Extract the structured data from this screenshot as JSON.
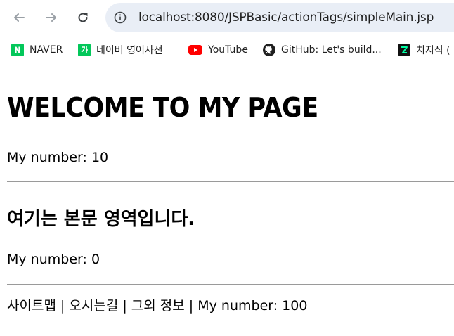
{
  "browser": {
    "url": "localhost:8080/JSPBasic/actionTags/simpleMain.jsp",
    "bookmarks": [
      {
        "label": "NAVER",
        "icon": "naver-icon"
      },
      {
        "label": "네이버 영어사전",
        "icon": "naver-dictionary-icon"
      },
      {
        "label": "YouTube",
        "icon": "youtube-icon"
      },
      {
        "label": "GitHub: Let's build...",
        "icon": "github-icon"
      },
      {
        "label": "치지직 (",
        "icon": "chzzk-icon"
      }
    ]
  },
  "page": {
    "header_title": "WELCOME TO MY PAGE",
    "header_number": "My number: 10",
    "body_title": "여기는 본문 영역입니다.",
    "body_number": "My number: 0",
    "footer_text": "사이트맵 | 오시는길 | 그외 정보 | My number: 100"
  },
  "colors": {
    "naver": "#03c75a",
    "youtube": "#ff0000",
    "omnibox": "#e9eef6",
    "divider": "#9a9a9a"
  }
}
